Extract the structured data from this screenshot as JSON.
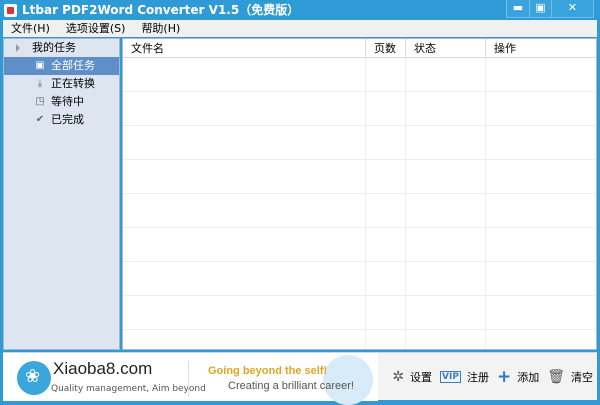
{
  "window": {
    "title": "Ltbar PDF2Word Converter V1.5（免费版）",
    "minimize": "▬",
    "maximize": "▣",
    "close": "✕"
  },
  "menu": [
    "文件(H)",
    "选项设置(S)",
    "帮助(H)"
  ],
  "sidebar": {
    "root": "我的任务",
    "items": [
      {
        "label": "全部任务",
        "icon": "all-tasks-icon",
        "glyph": "▣"
      },
      {
        "label": "正在转换",
        "icon": "download-icon",
        "glyph": "⤓"
      },
      {
        "label": "等待中",
        "icon": "waiting-icon",
        "glyph": "◳"
      },
      {
        "label": "已完成",
        "icon": "check-icon",
        "glyph": "✔"
      }
    ]
  },
  "table": {
    "columns": [
      "文件名",
      "页数",
      "状态",
      "操作"
    ],
    "rows": []
  },
  "banner": {
    "brand": "Xiaoba8.com",
    "tagline": "Quality management, Aim beyond",
    "slogan1": "Going beyond the self!",
    "slogan2": "Creating a brilliant career!"
  },
  "actions": [
    {
      "label": "设置",
      "glyph": "✲"
    },
    {
      "label": "注册",
      "glyph": "VIP"
    },
    {
      "label": "添加",
      "glyph": "+"
    },
    {
      "label": "清空",
      "glyph": "🗑"
    }
  ]
}
